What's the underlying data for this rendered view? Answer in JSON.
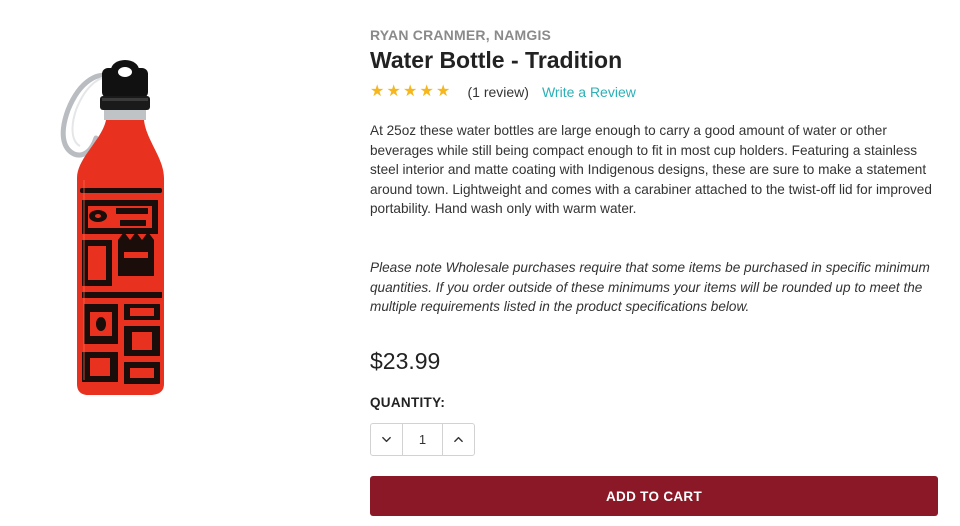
{
  "product": {
    "brand": "RYAN CRANMER, NAMGIS",
    "title": "Water Bottle - Tradition",
    "rating": 5,
    "review_count_text": "(1 review)",
    "write_review_label": "Write a Review",
    "description": "At 25oz these water bottles are large enough to carry a good amount of water or other beverages while still being compact enough to fit in most cup holders. Featuring a stainless steel interior and matte coating with Indigenous designs, these are sure to make a statement around town. Lightweight and comes with a carabiner attached to the twist-off lid for improved portability. Hand wash only with warm water.",
    "wholesale_note": "Please note Wholesale purchases require that some items be purchased in specific minimum quantities. If you order outside of these minimums your items will be rounded up to meet the multiple requirements listed in the product specifications below.",
    "price": "$23.99",
    "quantity_label": "QUANTITY:",
    "quantity_value": "1",
    "add_to_cart_label": "ADD TO CART"
  },
  "colors": {
    "star": "#f5b71d",
    "link": "#2bb0b7",
    "cart_button": "#8a1826",
    "bottle_red": "#e8321f"
  },
  "icons": {
    "decrement": "chevron-down-icon",
    "increment": "chevron-up-icon",
    "star": "star-icon"
  }
}
